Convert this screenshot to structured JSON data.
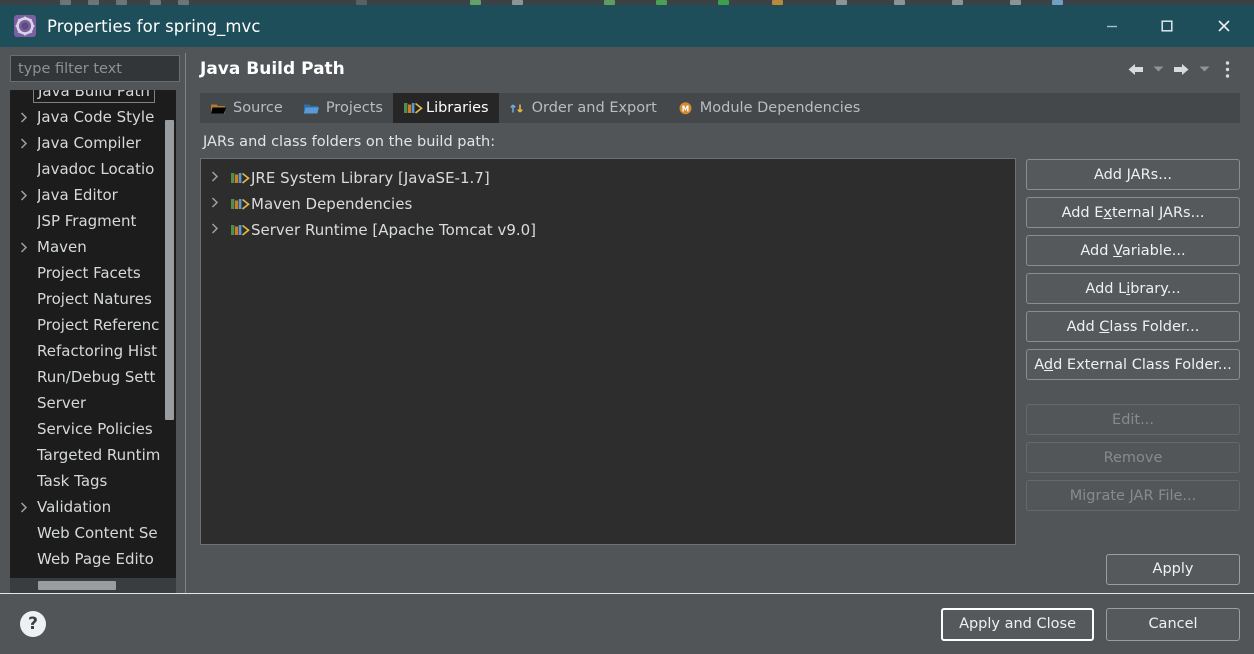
{
  "window": {
    "title": "Properties for spring_mvc",
    "icon": "gear-icon",
    "controls": {
      "minimize": "minimize-icon",
      "maximize": "maximize-icon",
      "close": "close-icon"
    },
    "titlebar_color": "#1e4e5a",
    "dialog_bg": "#515557"
  },
  "sidebar": {
    "filter": {
      "value": "",
      "placeholder": "type filter text"
    },
    "items": [
      {
        "label": "Java Build Path",
        "expandable": false,
        "selected": true
      },
      {
        "label": "Java Code Style",
        "expandable": true,
        "selected": false
      },
      {
        "label": "Java Compiler",
        "expandable": true,
        "selected": false
      },
      {
        "label": "Javadoc Locatio",
        "expandable": false,
        "selected": false
      },
      {
        "label": "Java Editor",
        "expandable": true,
        "selected": false
      },
      {
        "label": "JSP Fragment",
        "expandable": false,
        "selected": false
      },
      {
        "label": "Maven",
        "expandable": true,
        "selected": false
      },
      {
        "label": "Project Facets",
        "expandable": false,
        "selected": false
      },
      {
        "label": "Project Natures",
        "expandable": false,
        "selected": false
      },
      {
        "label": "Project Referenc",
        "expandable": false,
        "selected": false
      },
      {
        "label": "Refactoring Hist",
        "expandable": false,
        "selected": false
      },
      {
        "label": "Run/Debug Sett",
        "expandable": false,
        "selected": false
      },
      {
        "label": "Server",
        "expandable": false,
        "selected": false
      },
      {
        "label": "Service Policies",
        "expandable": false,
        "selected": false
      },
      {
        "label": "Targeted Runtim",
        "expandable": false,
        "selected": false
      },
      {
        "label": "Task Tags",
        "expandable": false,
        "selected": false
      },
      {
        "label": "Validation",
        "expandable": true,
        "selected": false
      },
      {
        "label": "Web Content Se",
        "expandable": false,
        "selected": false
      },
      {
        "label": "Web Page Edito",
        "expandable": false,
        "selected": false
      }
    ]
  },
  "header": {
    "page_title": "Java Build Path",
    "tools": [
      {
        "name": "back-arrow-icon",
        "glyph": "←"
      },
      {
        "name": "back-dropdown-icon",
        "glyph": "▾"
      },
      {
        "name": "forward-arrow-icon",
        "glyph": "→"
      },
      {
        "name": "forward-dropdown-icon",
        "glyph": "▾"
      },
      {
        "name": "view-menu-icon",
        "glyph": "⋮"
      }
    ]
  },
  "tabs": [
    {
      "label": "Source",
      "icon": "source-folder-icon",
      "active": false
    },
    {
      "label": "Projects",
      "icon": "projects-folder-icon",
      "active": false
    },
    {
      "label": "Libraries",
      "icon": "libraries-books-icon",
      "active": true
    },
    {
      "label": "Order and Export",
      "icon": "order-export-arrows-icon",
      "active": false
    },
    {
      "label": "Module Dependencies",
      "icon": "module-badge-icon",
      "active": false
    }
  ],
  "main": {
    "section_label": "JARs and class folders on the build path:",
    "entries": [
      {
        "label": "JRE System Library [JavaSE-1.7]",
        "icon": "library-icon",
        "expandable": true
      },
      {
        "label": "Maven Dependencies",
        "icon": "library-icon",
        "expandable": true
      },
      {
        "label": "Server Runtime [Apache Tomcat v9.0]",
        "icon": "library-icon",
        "expandable": true
      }
    ],
    "buttons": [
      {
        "label": "Add JARs...",
        "mnemonic": "J",
        "enabled": true
      },
      {
        "label": "Add External JARs...",
        "mnemonic": "x",
        "enabled": true
      },
      {
        "label": "Add Variable...",
        "mnemonic": "V",
        "enabled": true
      },
      {
        "label": "Add Library...",
        "mnemonic": "i",
        "enabled": true
      },
      {
        "label": "Add Class Folder...",
        "mnemonic": "C",
        "enabled": true
      },
      {
        "label": "Add External Class Folder...",
        "mnemonic": "d",
        "enabled": true
      },
      {
        "label": "Edit...",
        "mnemonic": "",
        "enabled": false
      },
      {
        "label": "Remove",
        "mnemonic": "",
        "enabled": false
      },
      {
        "label": "Migrate JAR File...",
        "mnemonic": "",
        "enabled": false
      }
    ],
    "apply_label": "Apply",
    "apply_mnemonic": "A"
  },
  "footer": {
    "help_icon": "help-question-icon",
    "help_glyph": "?",
    "apply_and_close": "Apply and Close",
    "cancel": "Cancel"
  }
}
